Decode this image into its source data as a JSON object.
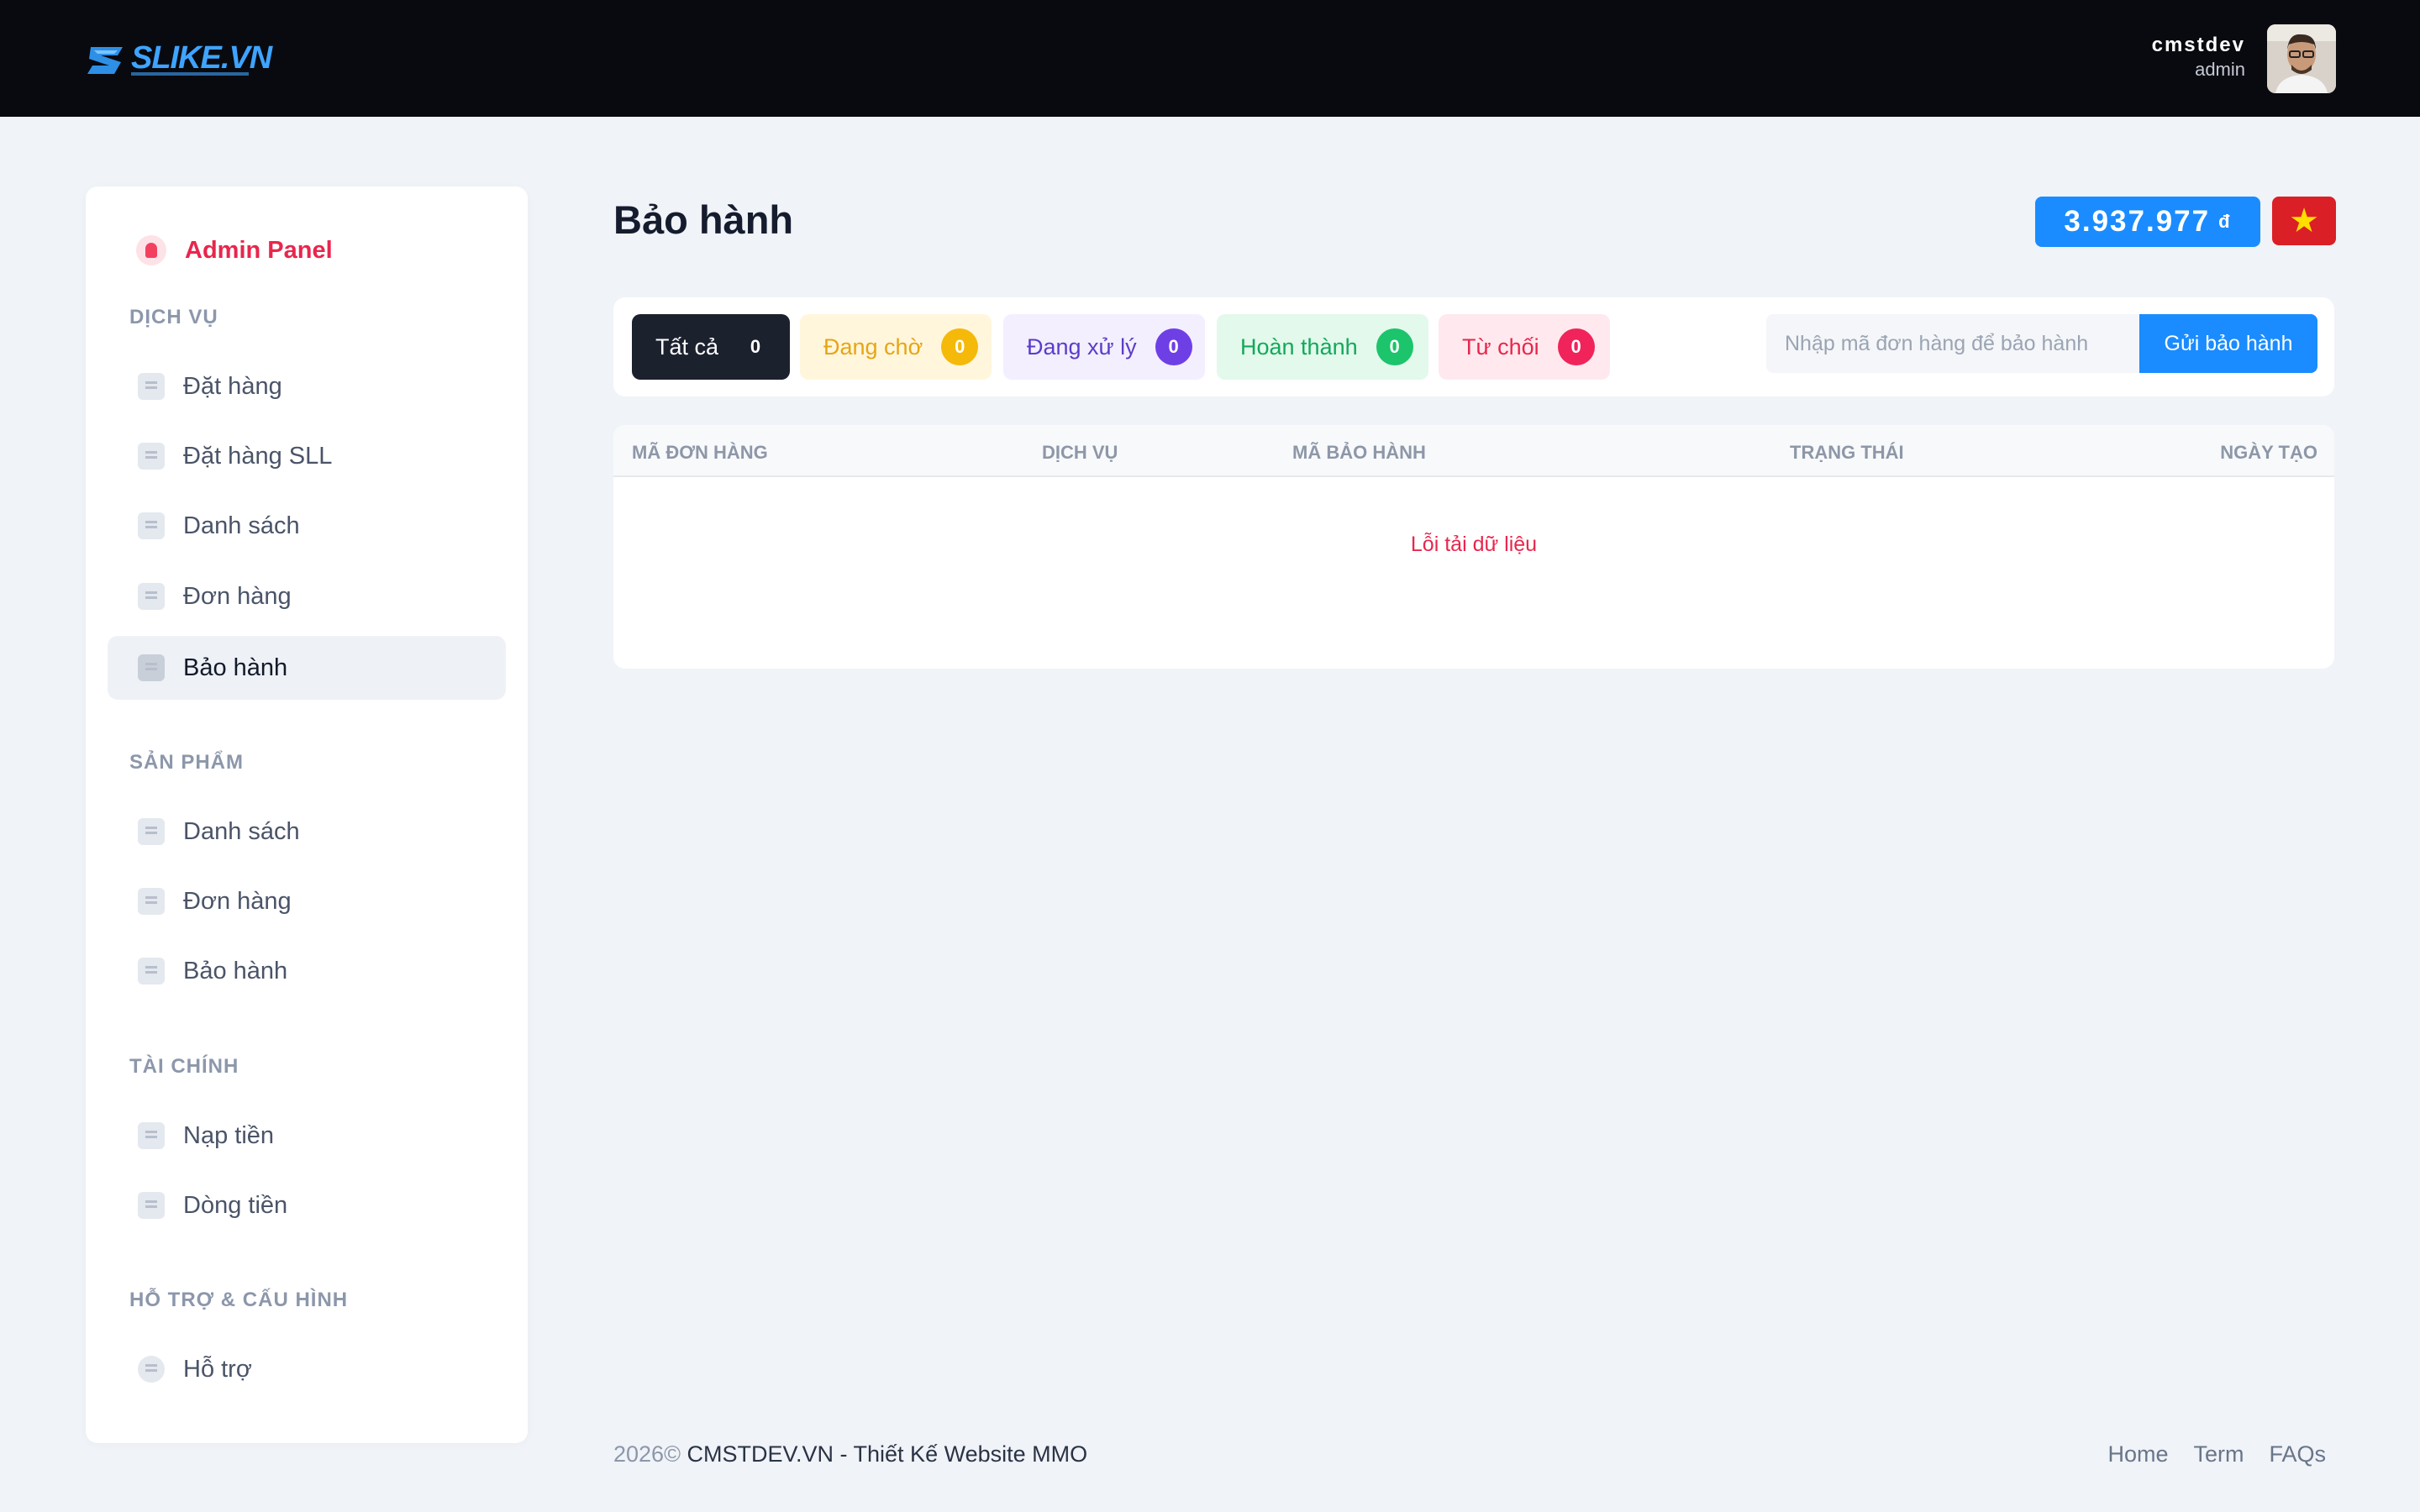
{
  "header": {
    "logo_text": "SLIKE.VN",
    "user": {
      "name": "cmstdev",
      "role": "admin"
    }
  },
  "sidebar": {
    "brand": "Admin Panel",
    "sections": [
      {
        "title": "DỊCH VỤ",
        "items": [
          {
            "label": "Đặt hàng",
            "icon": "cart-icon"
          },
          {
            "label": "Đặt hàng SLL",
            "icon": "basket-icon"
          },
          {
            "label": "Danh sách",
            "icon": "list-icon"
          },
          {
            "label": "Đơn hàng",
            "icon": "checklist-icon"
          },
          {
            "label": "Bảo hành",
            "icon": "warranty-icon",
            "active": true
          }
        ]
      },
      {
        "title": "SẢN PHẨM",
        "items": [
          {
            "label": "Danh sách",
            "icon": "box-icon"
          },
          {
            "label": "Đơn hàng",
            "icon": "checklist-icon"
          },
          {
            "label": "Bảo hành",
            "icon": "warranty-icon"
          }
        ]
      },
      {
        "title": "TÀI CHÍNH",
        "items": [
          {
            "label": "Nạp tiền",
            "icon": "credit-card-icon"
          },
          {
            "label": "Dòng tiền",
            "icon": "calculator-icon"
          }
        ]
      },
      {
        "title": "HỖ TRỢ & CẤU HÌNH",
        "items": [
          {
            "label": "Hỗ trợ",
            "icon": "help-icon"
          }
        ]
      }
    ]
  },
  "main": {
    "title": "Bảo hành",
    "balance": "3.937.977",
    "currency": "đ",
    "flag_icon": "vietnam-flag-icon",
    "tabs": [
      {
        "label": "Tất cả",
        "count": "0"
      },
      {
        "label": "Đang chờ",
        "count": "0"
      },
      {
        "label": "Đang xử lý",
        "count": "0"
      },
      {
        "label": "Hoàn thành",
        "count": "0"
      },
      {
        "label": "Từ chối",
        "count": "0"
      }
    ],
    "search": {
      "placeholder": "Nhập mã đơn hàng để bảo hành",
      "value": ""
    },
    "submit_label": "Gửi bảo hành",
    "table": {
      "columns": [
        "MÃ ĐƠN HÀNG",
        "DỊCH VỤ",
        "MÃ BẢO HÀNH",
        "TRẠNG THÁI",
        "NGÀY TẠO"
      ],
      "rows": [],
      "empty_message": "Lỗi tải dữ liệu"
    }
  },
  "footer": {
    "year": "2026©",
    "text": "CMSTDEV.VN - Thiết Kế Website MMO",
    "links": [
      "Home",
      "Term",
      "FAQs"
    ]
  },
  "colors": {
    "accent": "#1a8cff",
    "brand": "#e8264d",
    "header_bg": "#080a10",
    "pending": "#f5b90a",
    "processing": "#6f3fe6",
    "done": "#1cc46b",
    "reject": "#f0245a"
  }
}
